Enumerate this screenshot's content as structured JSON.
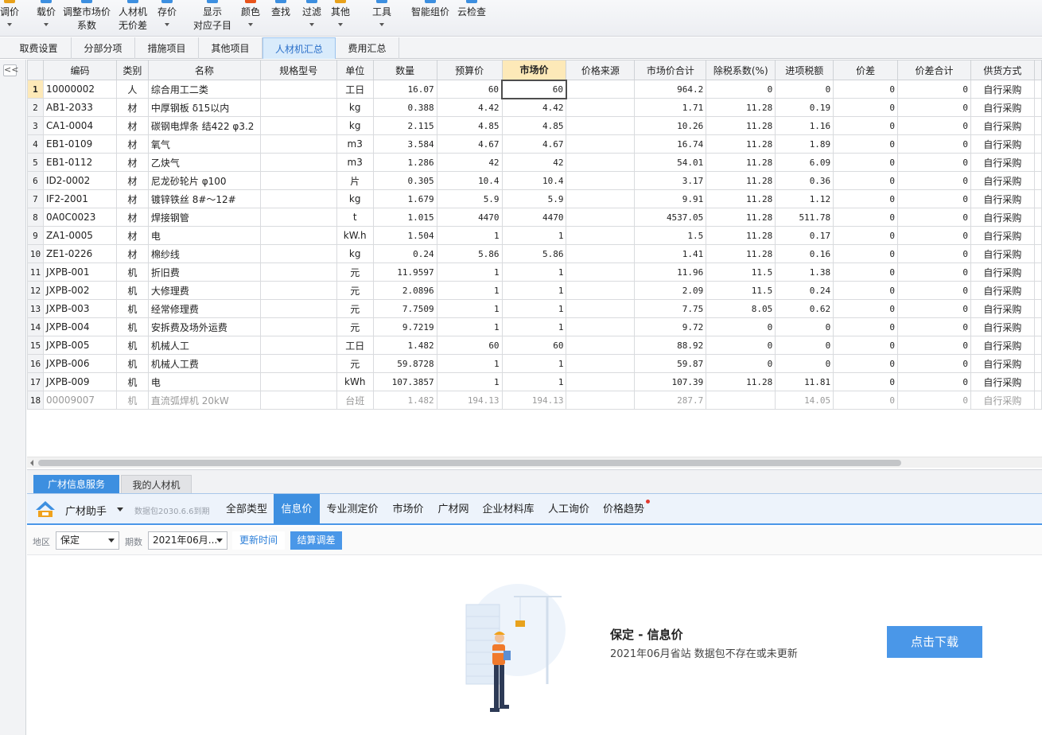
{
  "ribbon": {
    "buttons": [
      {
        "l1": "调价",
        "l2": "",
        "icon_color": "#e8a21c",
        "arrow": true
      },
      {
        "l1": "载价",
        "l2": "",
        "icon_color": "#3d8fe0",
        "arrow": true
      },
      {
        "l1": "调整市场价",
        "l2": "系数",
        "icon_color": "#3d8fe0",
        "arrow": false
      },
      {
        "l1": "人材机",
        "l2": "无价差",
        "icon_color": "#3d8fe0",
        "arrow": false
      },
      {
        "l1": "存价",
        "l2": "",
        "icon_color": "#3d8fe0",
        "arrow": true
      },
      {
        "l1": "显示",
        "l2": "对应子目",
        "icon_color": "#3d8fe0",
        "arrow": false
      },
      {
        "l1": "颜色",
        "l2": "",
        "icon_color": "#e8541c",
        "arrow": true
      },
      {
        "l1": "查找",
        "l2": "",
        "icon_color": "#3d8fe0",
        "arrow": false
      },
      {
        "l1": "过滤",
        "l2": "",
        "icon_color": "#3d8fe0",
        "arrow": true
      },
      {
        "l1": "其他",
        "l2": "",
        "icon_color": "#e8a21c",
        "arrow": true
      },
      {
        "l1": "工具",
        "l2": "",
        "icon_color": "#3d8fe0",
        "arrow": true
      },
      {
        "l1": "智能组价",
        "l2": "",
        "icon_color": "#3d8fe0",
        "arrow": false
      },
      {
        "l1": "云检查",
        "l2": "",
        "icon_color": "#3d8fe0",
        "arrow": false
      }
    ]
  },
  "tabs": [
    "取费设置",
    "分部分项",
    "措施项目",
    "其他项目",
    "人材机汇总",
    "费用汇总"
  ],
  "active_tab": "人材机汇总",
  "collapse_glyph": "<<",
  "table": {
    "headers": [
      "编码",
      "类别",
      "名称",
      "规格型号",
      "单位",
      "数量",
      "预算价",
      "市场价",
      "价格来源",
      "市场价合计",
      "除税系数(%)",
      "进项税额",
      "价差",
      "价差合计",
      "供货方式"
    ],
    "rows": [
      [
        "1",
        "10000002",
        "人",
        "综合用工二类",
        "",
        "工日",
        "16.07",
        "60",
        "60",
        "",
        "964.2",
        "0",
        "0",
        "0",
        "0",
        "自行采购"
      ],
      [
        "2",
        "AB1-2033",
        "材",
        "中厚钢板 δ15以内",
        "",
        "kg",
        "0.388",
        "4.42",
        "4.42",
        "",
        "1.71",
        "11.28",
        "0.19",
        "0",
        "0",
        "自行采购"
      ],
      [
        "3",
        "CA1-0004",
        "材",
        "碳钢电焊条 结422 φ3.2",
        "",
        "kg",
        "2.115",
        "4.85",
        "4.85",
        "",
        "10.26",
        "11.28",
        "1.16",
        "0",
        "0",
        "自行采购"
      ],
      [
        "4",
        "EB1-0109",
        "材",
        "氧气",
        "",
        "m3",
        "3.584",
        "4.67",
        "4.67",
        "",
        "16.74",
        "11.28",
        "1.89",
        "0",
        "0",
        "自行采购"
      ],
      [
        "5",
        "EB1-0112",
        "材",
        "乙炔气",
        "",
        "m3",
        "1.286",
        "42",
        "42",
        "",
        "54.01",
        "11.28",
        "6.09",
        "0",
        "0",
        "自行采购"
      ],
      [
        "6",
        "ID2-0002",
        "材",
        "尼龙砂轮片 φ100",
        "",
        "片",
        "0.305",
        "10.4",
        "10.4",
        "",
        "3.17",
        "11.28",
        "0.36",
        "0",
        "0",
        "自行采购"
      ],
      [
        "7",
        "IF2-2001",
        "材",
        "镀锌铁丝 8#～12#",
        "",
        "kg",
        "1.679",
        "5.9",
        "5.9",
        "",
        "9.91",
        "11.28",
        "1.12",
        "0",
        "0",
        "自行采购"
      ],
      [
        "8",
        "0A0C0023",
        "材",
        "焊接钢管",
        "",
        "t",
        "1.015",
        "4470",
        "4470",
        "",
        "4537.05",
        "11.28",
        "511.78",
        "0",
        "0",
        "自行采购"
      ],
      [
        "9",
        "ZA1-0005",
        "材",
        "电",
        "",
        "kW.h",
        "1.504",
        "1",
        "1",
        "",
        "1.5",
        "11.28",
        "0.17",
        "0",
        "0",
        "自行采购"
      ],
      [
        "10",
        "ZE1-0226",
        "材",
        "棉纱线",
        "",
        "kg",
        "0.24",
        "5.86",
        "5.86",
        "",
        "1.41",
        "11.28",
        "0.16",
        "0",
        "0",
        "自行采购"
      ],
      [
        "11",
        "JXPB-001",
        "机",
        "折旧费",
        "",
        "元",
        "11.9597",
        "1",
        "1",
        "",
        "11.96",
        "11.5",
        "1.38",
        "0",
        "0",
        "自行采购"
      ],
      [
        "12",
        "JXPB-002",
        "机",
        "大修理费",
        "",
        "元",
        "2.0896",
        "1",
        "1",
        "",
        "2.09",
        "11.5",
        "0.24",
        "0",
        "0",
        "自行采购"
      ],
      [
        "13",
        "JXPB-003",
        "机",
        "经常修理费",
        "",
        "元",
        "7.7509",
        "1",
        "1",
        "",
        "7.75",
        "8.05",
        "0.62",
        "0",
        "0",
        "自行采购"
      ],
      [
        "14",
        "JXPB-004",
        "机",
        "安拆费及场外运费",
        "",
        "元",
        "9.7219",
        "1",
        "1",
        "",
        "9.72",
        "0",
        "0",
        "0",
        "0",
        "自行采购"
      ],
      [
        "15",
        "JXPB-005",
        "机",
        "机械人工",
        "",
        "工日",
        "1.482",
        "60",
        "60",
        "",
        "88.92",
        "0",
        "0",
        "0",
        "0",
        "自行采购"
      ],
      [
        "16",
        "JXPB-006",
        "机",
        "机械人工费",
        "",
        "元",
        "59.8728",
        "1",
        "1",
        "",
        "59.87",
        "0",
        "0",
        "0",
        "0",
        "自行采购"
      ],
      [
        "17",
        "JXPB-009",
        "机",
        "电",
        "",
        "kWh",
        "107.3857",
        "1",
        "1",
        "",
        "107.39",
        "11.28",
        "11.81",
        "0",
        "0",
        "自行采购"
      ],
      [
        "18",
        "00009007",
        "机",
        "直流弧焊机 20kW",
        "",
        "台班",
        "1.482",
        "194.13",
        "194.13",
        "",
        "287.7",
        "",
        "14.05",
        "0",
        "0",
        "自行采购"
      ]
    ]
  },
  "bottom": {
    "panel_tabs": [
      "广材信息服务",
      "我的人材机"
    ],
    "helper_label": "广材助手",
    "package_note": "数据包2030.6.6到期",
    "service_tabs": [
      "全部类型",
      "信息价",
      "专业测定价",
      "市场价",
      "广材网",
      "企业材料库",
      "人工询价",
      "价格趋势"
    ],
    "active_service_tab": "信息价",
    "region_label": "地区",
    "region_value": "保定",
    "period_label": "期数",
    "period_value": "2021年06月...",
    "update_time_label": "更新时间",
    "settle_label": "结算调差",
    "message_title": "保定 - 信息价",
    "message_sub": "2021年06月省站 数据包不存在或未更新",
    "download_label": "点击下载"
  },
  "colors": {
    "accent_blue": "#3d8fe0",
    "header_highlight": "#fde9b8",
    "notify_red": "#e23a2f"
  }
}
